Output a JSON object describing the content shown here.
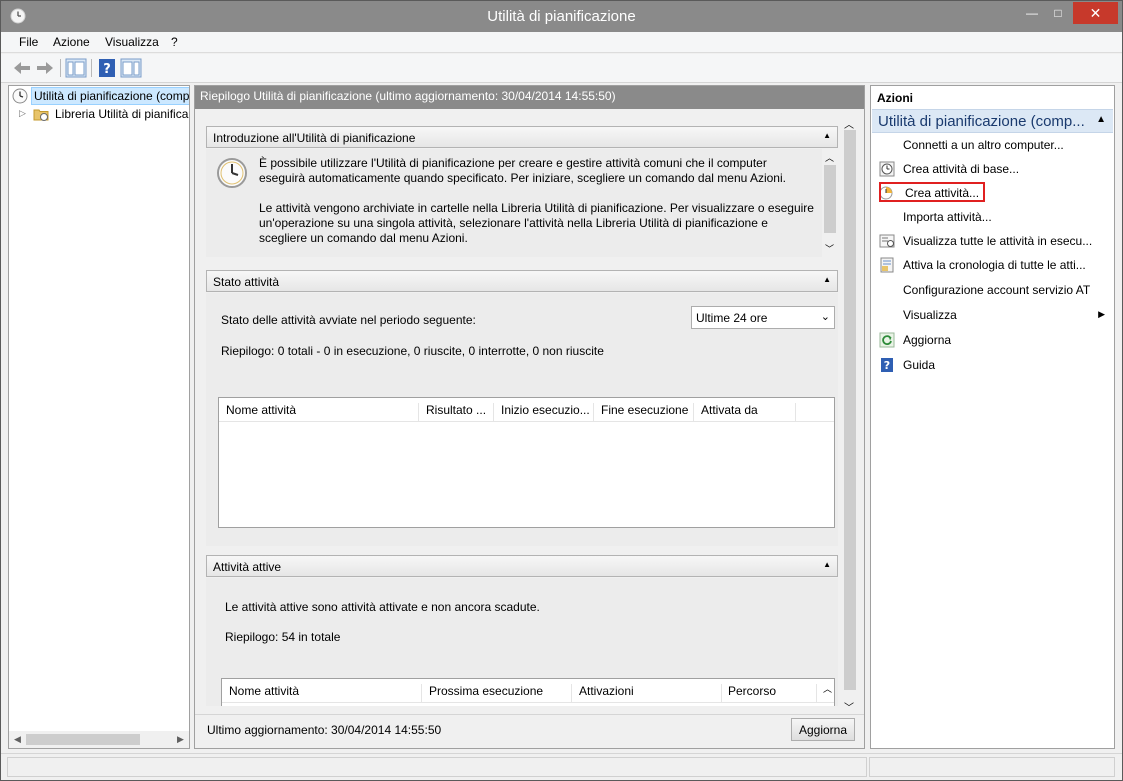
{
  "window": {
    "title": "Utilità di pianificazione"
  },
  "titlebar_buttons": {
    "minimize": "—",
    "maximize": "□",
    "close": "✕"
  },
  "menu": {
    "file": "File",
    "azione": "Azione",
    "visualizza": "Visualizza",
    "help": "?"
  },
  "tree": {
    "root": "Utilità di pianificazione (comp",
    "library": "Libreria Utilità di pianifica"
  },
  "center": {
    "header": "Riepilogo Utilità di pianificazione (ultimo aggiornamento: 30/04/2014 14:55:50)",
    "intro": {
      "title": "Introduzione all'Utilità di pianificazione",
      "para1_line1": "È possibile utilizzare l'Utilità di pianificazione per creare e gestire attività comuni che il computer",
      "para1_line2": "eseguirà automaticamente quando specificato. Per iniziare, scegliere un comando dal menu Azioni.",
      "para2_line1": "Le attività vengono archiviate in cartelle nella Libreria Utilità di pianificazione. Per visualizzare o eseguire",
      "para2_line2": "un'operazione su una singola attività, selezionare l'attività nella Libreria Utilità di pianificazione e",
      "para2_line3": "scegliere un comando dal menu Azioni."
    },
    "status": {
      "title": "Stato attività",
      "period_label": "Stato delle attività avviate nel periodo seguente:",
      "period_value": "Ultime 24 ore",
      "summary": "Riepilogo: 0 totali - 0 in esecuzione, 0 riuscite, 0 interrotte, 0 non riuscite",
      "columns": [
        "Nome attività",
        "Risultato ...",
        "Inizio esecuzio...",
        "Fine esecuzione",
        "Attivata da"
      ]
    },
    "active": {
      "title": "Attività attive",
      "description": "Le attività attive sono attività attivate e non ancora scadute.",
      "summary": "Riepilogo: 54 in totale",
      "columns": [
        "Nome attività",
        "Prossima esecuzione",
        "Attivazioni",
        "Percorso"
      ]
    },
    "footer": {
      "last_update": "Ultimo aggiornamento: 30/04/2014 14:55:50",
      "refresh_button": "Aggiorna"
    }
  },
  "actions": {
    "title": "Azioni",
    "group": "Utilità di pianificazione (comp...",
    "items": [
      {
        "label": "Connetti a un altro computer...",
        "icon": "none"
      },
      {
        "label": "Crea attività di base...",
        "icon": "clock-icon"
      },
      {
        "label": "Crea attività...",
        "icon": "new-task-icon"
      },
      {
        "label": "Importa attività...",
        "icon": "none"
      },
      {
        "label": "Visualizza tutte le attività in esecu...",
        "icon": "task-list-icon"
      },
      {
        "label": "Attiva la cronologia di tutte le atti...",
        "icon": "history-icon"
      },
      {
        "label": "Configurazione account servizio AT",
        "icon": "none"
      },
      {
        "label": "Visualizza",
        "icon": "none"
      },
      {
        "label": "Aggiorna",
        "icon": "refresh-icon"
      },
      {
        "label": "Guida",
        "icon": "help-icon"
      }
    ]
  },
  "colors": {
    "accent_highlight": "#e02020",
    "title_bar": "#8a8a8a",
    "selection": "#cce8ff"
  }
}
